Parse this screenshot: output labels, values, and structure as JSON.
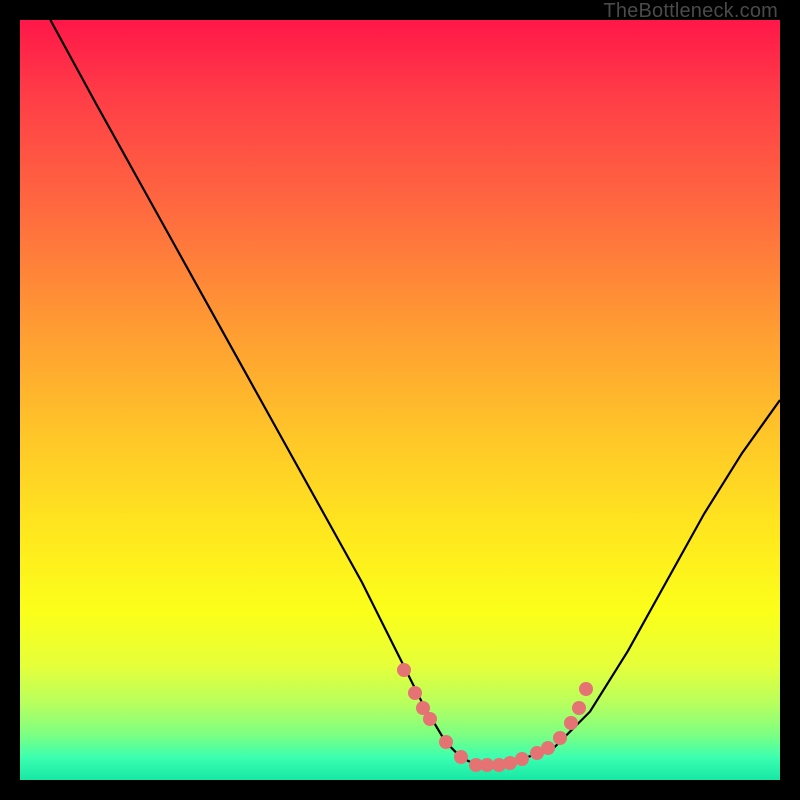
{
  "watermark": "TheBottleneck.com",
  "colors": {
    "dot": "#e57373",
    "curve": "#000000",
    "frame": "#000000"
  },
  "chart_data": {
    "type": "line",
    "title": "",
    "xlabel": "",
    "ylabel": "",
    "xlim": [
      0,
      100
    ],
    "ylim": [
      0,
      100
    ],
    "grid": false,
    "legend": false,
    "series": [
      {
        "name": "bottleneck-curve",
        "x": [
          4,
          10,
          15,
          20,
          25,
          30,
          35,
          40,
          45,
          50,
          53,
          56,
          58,
          60,
          62,
          65,
          70,
          75,
          80,
          85,
          90,
          95,
          100
        ],
        "y": [
          100,
          89,
          80,
          71,
          62,
          53,
          44,
          35,
          26,
          16,
          10,
          5,
          3,
          2,
          2,
          2.5,
          4,
          9,
          17,
          26,
          35,
          43,
          50
        ]
      }
    ],
    "markers": {
      "name": "highlighted-points",
      "x": [
        50.5,
        52.0,
        53.0,
        54.0,
        56.0,
        58.0,
        60.0,
        61.5,
        63.0,
        64.5,
        66.0,
        68.0,
        69.5,
        71.0,
        72.5,
        73.5,
        74.5
      ],
      "y": [
        14.5,
        11.5,
        9.5,
        8.0,
        5.0,
        3.0,
        2.0,
        2.0,
        2.0,
        2.3,
        2.8,
        3.5,
        4.2,
        5.5,
        7.5,
        9.5,
        12.0
      ]
    }
  }
}
